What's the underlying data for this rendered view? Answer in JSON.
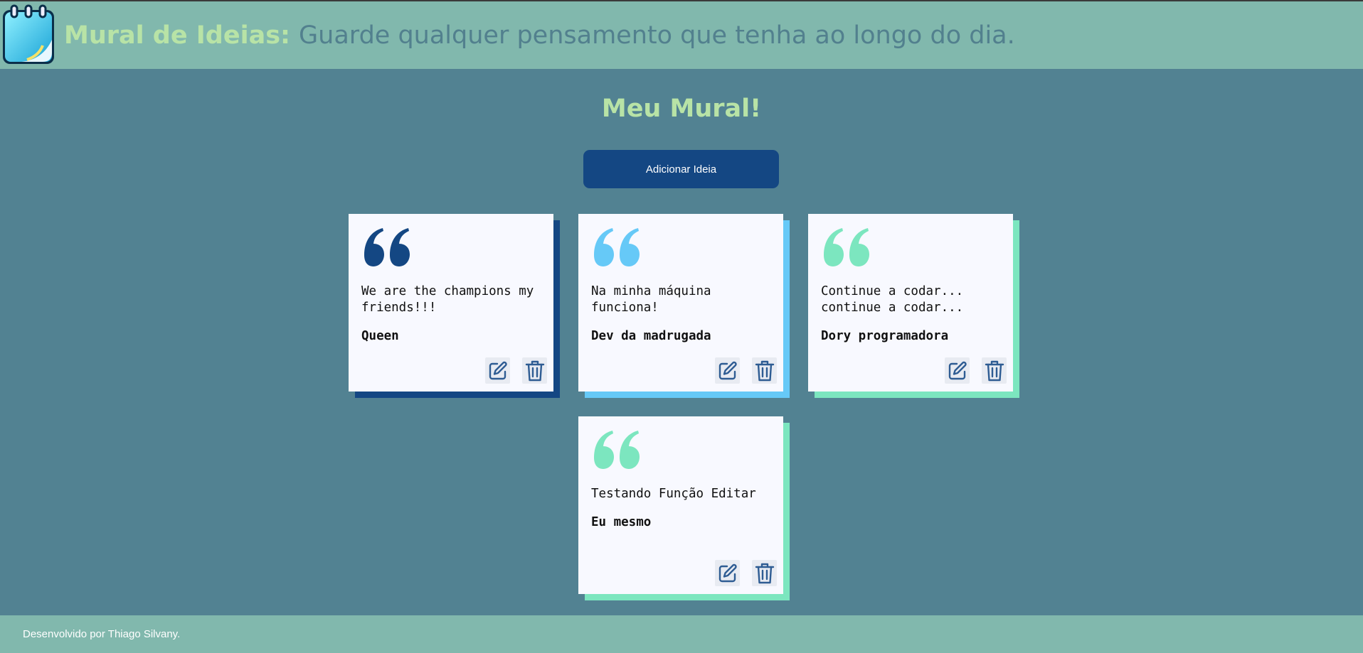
{
  "header": {
    "brand": "Mural de Ideias:",
    "tagline": "Guarde qualquer pensamento que tenha ao longo do dia.",
    "logo_icon": "notepad-calendar-icon"
  },
  "main": {
    "title": "Meu Mural!",
    "add_button_label": "Adicionar Ideia"
  },
  "cards": [
    {
      "text": "We are the champions my friends!!!",
      "author": "Queen",
      "accent": "#144783",
      "quote_icon": "quote-icon",
      "edit_icon": "edit-icon",
      "delete_icon": "trash-icon"
    },
    {
      "text": "Na minha máquina funciona!",
      "author": "Dev da madrugada",
      "accent": "#66c9f7",
      "quote_icon": "quote-icon",
      "edit_icon": "edit-icon",
      "delete_icon": "trash-icon"
    },
    {
      "text": "Continue a codar... continue a codar...",
      "author": "Dory programadora",
      "accent": "#7ce6bf",
      "quote_icon": "quote-icon",
      "edit_icon": "edit-icon",
      "delete_icon": "trash-icon"
    },
    {
      "text": "Testando Função Editar",
      "author": "Eu mesmo",
      "accent": "#7ce6bf",
      "quote_icon": "quote-icon",
      "edit_icon": "edit-icon",
      "delete_icon": "trash-icon"
    }
  ],
  "footer": {
    "credit": "Desenvolvido por Thiago Silvany."
  },
  "colors": {
    "background": "#528292",
    "header_bg": "#81b8ad",
    "brand_green": "#b8e3a6",
    "button_blue": "#144783"
  }
}
